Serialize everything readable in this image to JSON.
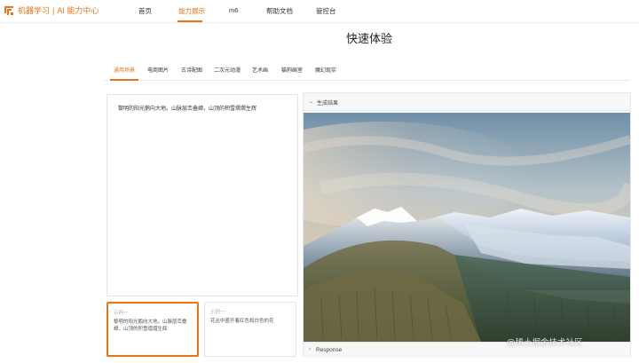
{
  "header": {
    "brand_name": "机器学习",
    "brand_separator": "|",
    "brand_sub": "AI 能力中心",
    "nav": [
      {
        "label": "首页",
        "active": false
      },
      {
        "label": "能力展示",
        "active": true
      },
      {
        "label": "m6",
        "active": false
      },
      {
        "label": "帮助文档",
        "active": false
      },
      {
        "label": "管控台",
        "active": false
      }
    ]
  },
  "page": {
    "title": "快速体验"
  },
  "tabs": [
    {
      "label": "通用场景",
      "active": true
    },
    {
      "label": "电商图片",
      "active": false
    },
    {
      "label": "古诗配图",
      "active": false
    },
    {
      "label": "二次元动漫",
      "active": false
    },
    {
      "label": "艺术画",
      "active": false
    },
    {
      "label": "猫狗画室",
      "active": false
    },
    {
      "label": "魔幻现实",
      "active": false
    }
  ],
  "prompt": {
    "value": "黎明的阳光鹅向大地。山脉层峦叠嶂，山顶的积雪熠熠生辉"
  },
  "examples": [
    {
      "label": "示例一",
      "text": "黎明的阳光鹅向大地。山脉层峦叠嶂，山顶的积雪熠熠生辉",
      "selected": true
    },
    {
      "label": "示例一",
      "text": "花丛中盛开着红色和白色的花",
      "selected": false
    }
  ],
  "result": {
    "header_label": "生成结果",
    "response_label": "Response"
  },
  "watermark": "@稀土掘金技术社区",
  "colors": {
    "accent": "#e8751a"
  }
}
